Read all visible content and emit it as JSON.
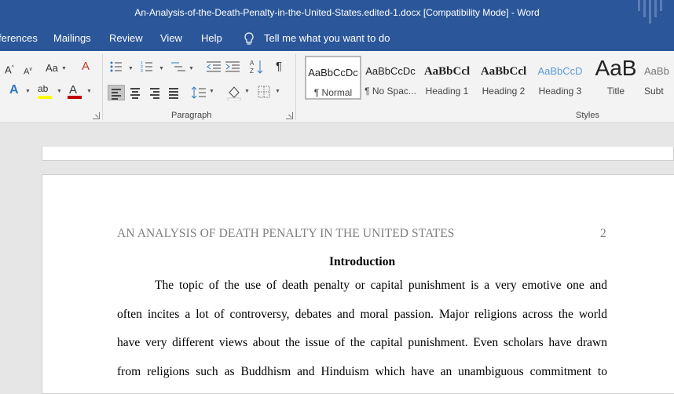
{
  "titlebar": {
    "title": "An-Analysis-of-the-Death-Penalty-in-the-United-States.edited-1.docx [Compatibility Mode]  -  Word",
    "background": "#2b579a"
  },
  "menu": {
    "tabs": [
      "ferences",
      "Mailings",
      "Review",
      "View",
      "Help"
    ],
    "tell_me": "Tell me what you want to do",
    "tell_icon": "lightbulb-icon"
  },
  "ribbon": {
    "paragraph_label": "Paragraph",
    "styles_label": "Styles",
    "font_aa": "Aa",
    "styles": [
      {
        "sample": "AaBbCcDc",
        "label": "¶ Normal",
        "selected": true
      },
      {
        "sample": "AaBbCcDc",
        "label": "¶ No Spac...",
        "selected": false
      },
      {
        "sample": "AaBbCcl",
        "label": "Heading 1",
        "selected": false
      },
      {
        "sample": "AaBbCcl",
        "label": "Heading 2",
        "selected": false
      },
      {
        "sample": "AaBbCcD",
        "label": "Heading 3",
        "selected": false
      },
      {
        "sample": "AaB",
        "label": "Title",
        "selected": false
      },
      {
        "sample": "AaBb",
        "label": "Subt",
        "selected": false
      }
    ]
  },
  "document": {
    "running_header": "AN ANALYSIS OF DEATH PENALTY IN THE UNITED STATES",
    "page_number": "2",
    "heading": "Introduction",
    "lines": [
      "The topic of the use of death penalty or capital punishment is a very emotive one and",
      "often incites a lot of controversy, debates and moral passion. Major religions across the world",
      "have very different views about the issue of the capital punishment. Even scholars have drawn",
      "from religions such as Buddhism and Hinduism which have an unambiguous commitment to"
    ]
  }
}
